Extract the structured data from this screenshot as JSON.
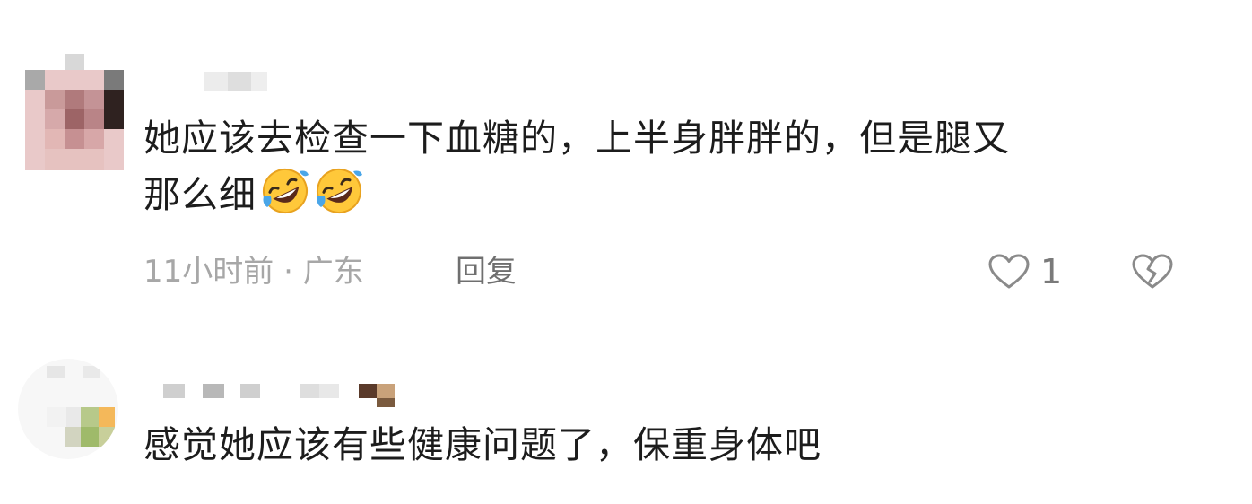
{
  "comments": [
    {
      "text_line1": "她应该去检查一下血糖的，上半身胖胖的，但是腿又",
      "text_line2": "那么细",
      "emoji": "rolling-on-floor-laughing-emoji",
      "time": "11小时前",
      "separator": "·",
      "location": "广东",
      "reply_label": "回复",
      "like_count": "1"
    },
    {
      "text_line1": "感觉她应该有些健康问题了，保重身体吧"
    }
  ],
  "colors": {
    "text": "#1c1c1c",
    "meta": "#a7a7a7",
    "reply": "#6f6f6f",
    "icon": "#8a8a8a",
    "emoji_face": "#ffc83a",
    "emoji_tear": "#4aa6e8"
  }
}
